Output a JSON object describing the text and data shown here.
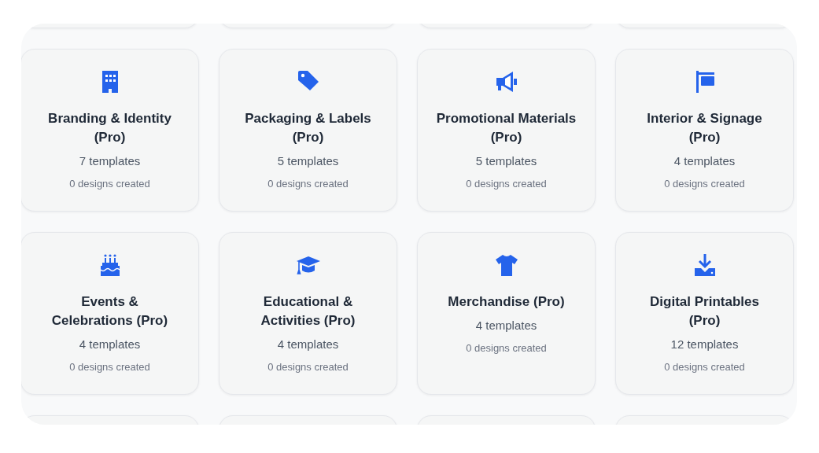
{
  "categories": [
    {
      "kind": "building",
      "title": "Branding & Identity (Pro)",
      "templates": "7 templates",
      "designs": "0 designs created"
    },
    {
      "kind": "tag",
      "title": "Packaging & Labels (Pro)",
      "templates": "5 templates",
      "designs": "0 designs created"
    },
    {
      "kind": "megaphone",
      "title": "Promotional Materials (Pro)",
      "templates": "5 templates",
      "designs": "0 designs created"
    },
    {
      "kind": "sign",
      "title": "Interior & Signage (Pro)",
      "templates": "4 templates",
      "designs": "0 designs created"
    },
    {
      "kind": "cake",
      "title": "Events & Celebrations (Pro)",
      "templates": "4 templates",
      "designs": "0 designs created"
    },
    {
      "kind": "cap",
      "title": "Educational & Activities (Pro)",
      "templates": "4 templates",
      "designs": "0 designs created"
    },
    {
      "kind": "shirt",
      "title": "Merchandise (Pro)",
      "templates": "4 templates",
      "designs": "0 designs created"
    },
    {
      "kind": "download",
      "title": "Digital Printables (Pro)",
      "templates": "12 templates",
      "designs": "0 designs created"
    }
  ]
}
